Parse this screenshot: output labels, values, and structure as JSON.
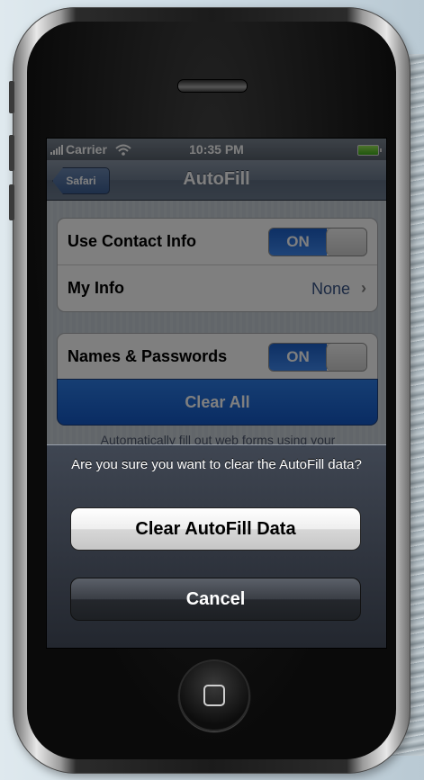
{
  "status_bar": {
    "carrier": "Carrier",
    "time": "10:35 PM",
    "icons": [
      "signal-bars-icon",
      "wifi-icon",
      "battery-icon"
    ]
  },
  "nav": {
    "back_label": "Safari",
    "title": "AutoFill"
  },
  "settings": {
    "use_contact_info": {
      "label": "Use Contact Info",
      "toggle": "ON"
    },
    "my_info": {
      "label": "My Info",
      "value": "None"
    },
    "names_passwords": {
      "label": "Names & Passwords",
      "toggle": "ON"
    },
    "clear_all_label": "Clear All",
    "footer_text": "Automatically fill out web forms using your"
  },
  "action_sheet": {
    "message": "Are you sure you want to clear the AutoFill data?",
    "confirm_label": "Clear AutoFill Data",
    "cancel_label": "Cancel"
  },
  "colors": {
    "toggle_on": "#2f76e0",
    "destructive_blue": "#1a63d6",
    "nav_bar": "#6d7b8e",
    "value_text": "#385487"
  }
}
